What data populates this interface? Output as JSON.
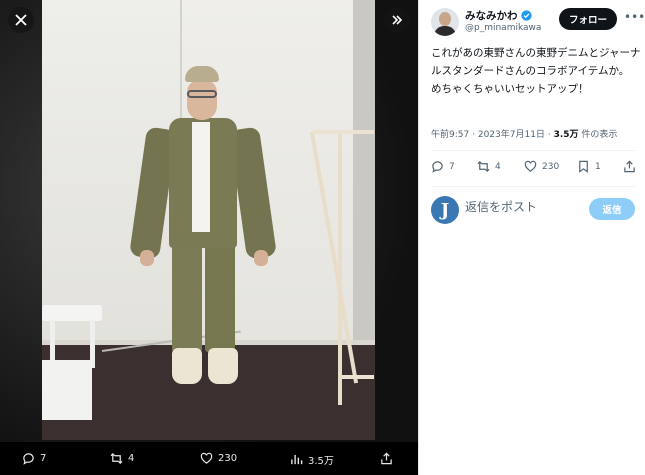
{
  "viewer": {
    "close_icon": "close-icon",
    "expand_icon": "expand-panel-icon"
  },
  "media_bar": {
    "replies": "7",
    "reposts": "4",
    "likes": "230",
    "views": "3.5万"
  },
  "author": {
    "name": "みなみかわ",
    "handle": "@p_minamikawa",
    "verified": true
  },
  "follow_label": "フォロー",
  "tweet_text": "これがあの東野さんの東野デニムとジャーナルスタンダードさんのコラボアイテムか。\nめちゃくちゃいいセットアップ！",
  "meta": {
    "time": "午前9:57",
    "separator": "·",
    "date": "2023年7月11日",
    "views_count": "3.5万",
    "views_label": "件の表示"
  },
  "actions": {
    "replies": "7",
    "reposts": "4",
    "likes": "230",
    "bookmarks": "1"
  },
  "reply": {
    "avatar_letter": "J",
    "placeholder": "返信をポスト",
    "button_label": "返信"
  },
  "colors": {
    "accent": "#1d9bf0",
    "reply_button": "#8ecdf8",
    "follow_button": "#0f1419"
  }
}
